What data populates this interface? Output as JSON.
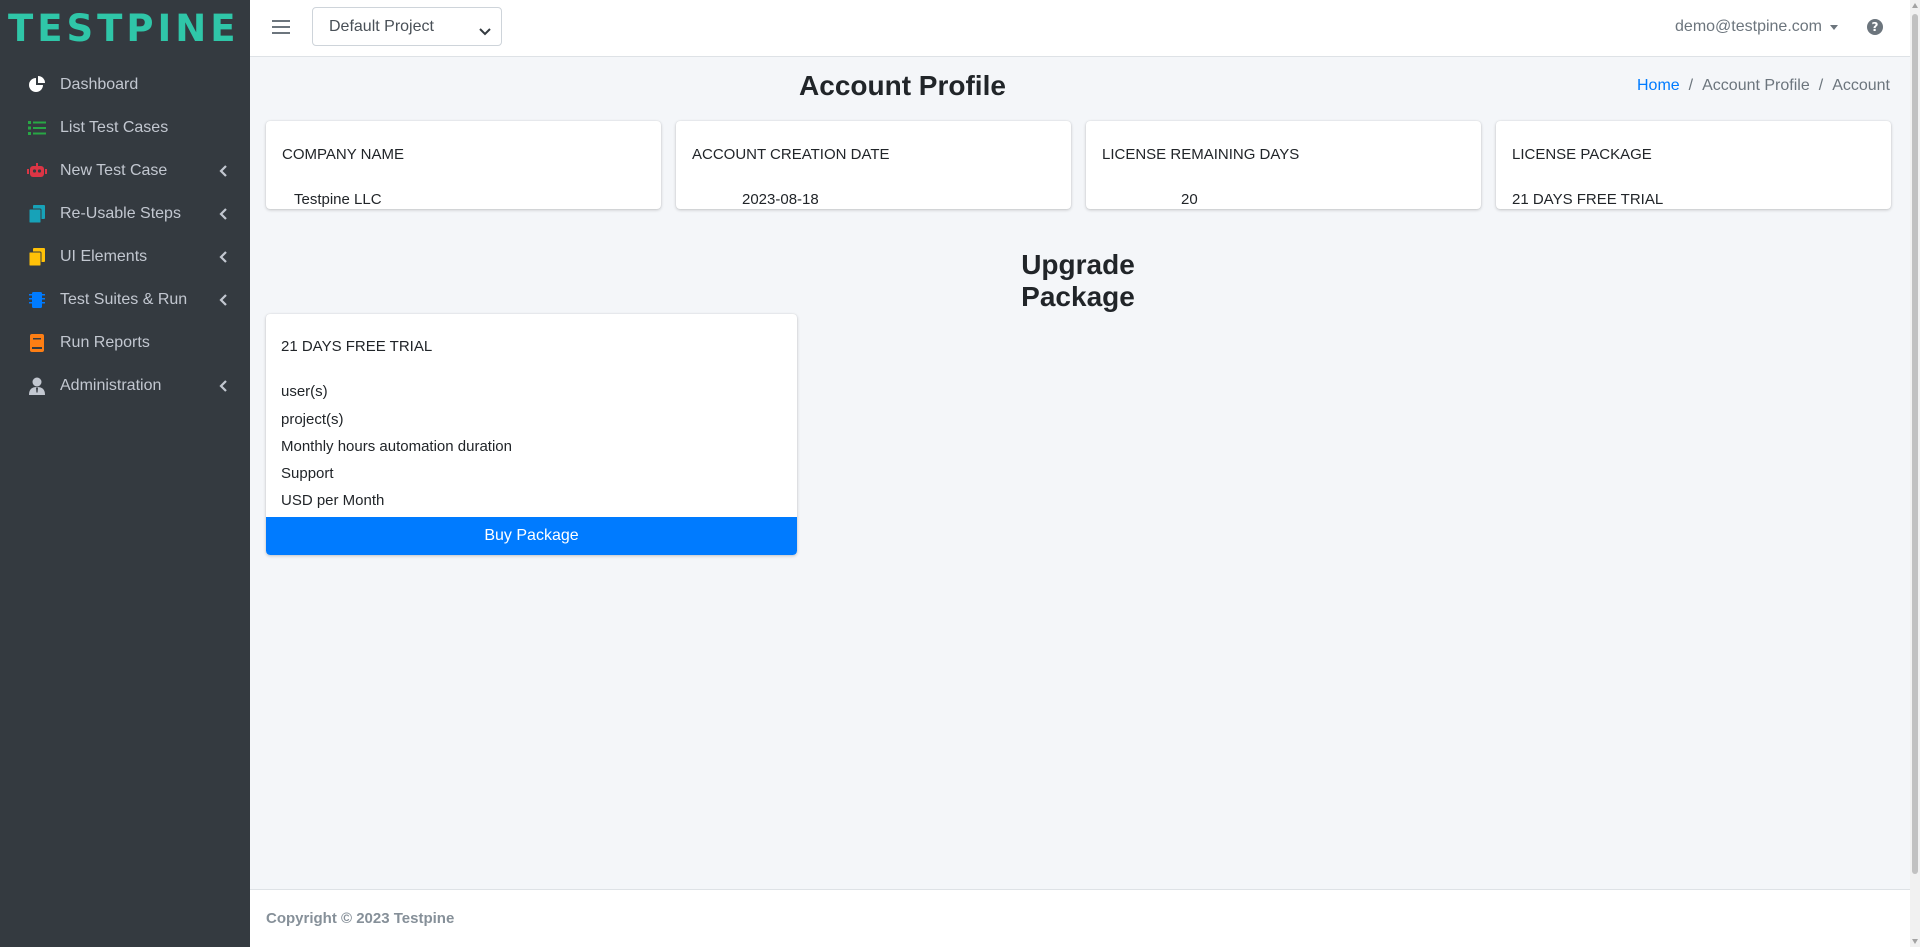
{
  "brand": {
    "name": "TESTPINE",
    "color": "#2fc6a8"
  },
  "sidebar": {
    "items": [
      {
        "label": "Dashboard",
        "icon": "pie-chart-icon",
        "icon_color": "#ffffff",
        "has_submenu": false
      },
      {
        "label": "List Test Cases",
        "icon": "list-icon",
        "icon_color": "#28a745",
        "has_submenu": false
      },
      {
        "label": "New Test Case",
        "icon": "robot-icon",
        "icon_color": "#dc3545",
        "has_submenu": true
      },
      {
        "label": "Re-Usable Steps",
        "icon": "copy-icon",
        "icon_color": "#17a2b8",
        "has_submenu": true
      },
      {
        "label": "UI Elements",
        "icon": "files-icon",
        "icon_color": "#ffc107",
        "has_submenu": true
      },
      {
        "label": "Test Suites & Run",
        "icon": "microchip-icon",
        "icon_color": "#007bff",
        "has_submenu": true
      },
      {
        "label": "Run Reports",
        "icon": "book-icon",
        "icon_color": "#fd7e14",
        "has_submenu": false
      },
      {
        "label": "Administration",
        "icon": "user-tie-icon",
        "icon_color": "#c2c7d0",
        "has_submenu": true
      }
    ]
  },
  "topbar": {
    "project_select": {
      "value": "Default Project"
    },
    "user_email": "demo@testpine.com",
    "help_icon": "question-circle-icon"
  },
  "page": {
    "title": "Account Profile",
    "breadcrumb": [
      "Home",
      "Account Profile",
      "Account"
    ]
  },
  "info_cards": [
    {
      "label": "COMPANY NAME",
      "value": "Testpine LLC"
    },
    {
      "label": "ACCOUNT CREATION DATE",
      "value": "2023-08-18"
    },
    {
      "label": "LICENSE REMAINING DAYS",
      "value": "20"
    },
    {
      "label": "LICENSE PACKAGE",
      "value": "21 DAYS FREE TRIAL"
    }
  ],
  "upgrade": {
    "title": "Upgrade Package",
    "package": {
      "name": "21 DAYS FREE TRIAL",
      "lines": [
        "user(s)",
        "project(s)",
        "Monthly hours automation duration",
        "Support",
        "USD per Month"
      ],
      "button_label": "Buy Package"
    }
  },
  "footer": {
    "copyright": "Copyright © 2023 Testpine"
  },
  "colors": {
    "accent": "#007bff",
    "sidebar_bg": "#343a40",
    "content_bg": "#f4f6f9"
  }
}
